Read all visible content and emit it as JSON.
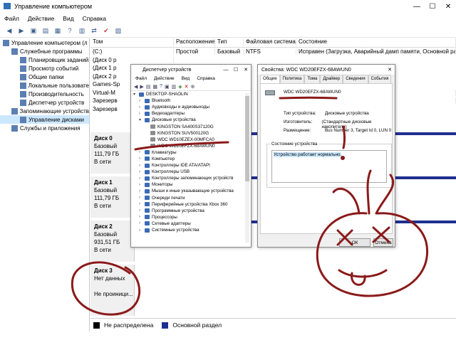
{
  "app": {
    "title": "Управление компьютером",
    "menu": [
      "Файл",
      "Действие",
      "Вид",
      "Справка"
    ]
  },
  "tree": [
    {
      "label": "Управление компьютером (л",
      "icon": "computer-icon",
      "indent": 0
    },
    {
      "label": "Служебные программы",
      "icon": "tools-icon",
      "indent": 1
    },
    {
      "label": "Планировщик заданий",
      "icon": "clock-icon",
      "indent": 2
    },
    {
      "label": "Просмотр событий",
      "icon": "event-icon",
      "indent": 2
    },
    {
      "label": "Общие папки",
      "icon": "folder-icon",
      "indent": 2
    },
    {
      "label": "Локальные пользовате",
      "icon": "users-icon",
      "indent": 2
    },
    {
      "label": "Производительность",
      "icon": "perf-icon",
      "indent": 2
    },
    {
      "label": "Диспетчер устройств",
      "icon": "device-icon",
      "indent": 2
    },
    {
      "label": "Запоминающие устройств",
      "icon": "storage-icon",
      "indent": 1
    },
    {
      "label": "Управление дисками",
      "icon": "disk-icon",
      "indent": 2,
      "selected": true
    },
    {
      "label": "Службы и приложения",
      "icon": "services-icon",
      "indent": 1
    }
  ],
  "volumes": {
    "headers": [
      "Том",
      "Расположение",
      "Тип",
      "Файловая система",
      "Состояние"
    ],
    "rows": [
      [
        "(C:)",
        "Простой",
        "Базовый",
        "NTFS",
        "Исправен (Загрузка, Аварийный дамп памяти, Основной разд"
      ],
      [
        "(Диск 0 р",
        "",
        "",
        "",
        ""
      ],
      [
        "(Диск 1 р",
        "",
        "",
        "",
        ""
      ],
      [
        "(Диск 2 р",
        "",
        "",
        "",
        ""
      ],
      [
        "Games-Sp",
        "",
        "",
        "",
        ""
      ],
      [
        "Virtual-M",
        "",
        "",
        "",
        "ой раздел)"
      ],
      [
        "Зарезерв",
        "",
        "",
        "",
        "ел)"
      ],
      [
        "Зарезерв",
        "",
        "",
        "",
        ""
      ]
    ]
  },
  "disks": [
    {
      "name": "Диск 0",
      "type": "Базовый",
      "size": "111,79 ГБ",
      "status": "В сети"
    },
    {
      "name": "Диск 1",
      "type": "Базовый",
      "size": "111,79 ГБ",
      "status": "В сети"
    },
    {
      "name": "Диск 2",
      "type": "Базовый",
      "size": "931,51 ГБ",
      "status": "В сети"
    },
    {
      "name": "Диск 3",
      "type": "Нет данных",
      "size": "",
      "status": "Не проиници..."
    }
  ],
  "legend": [
    {
      "label": "Не распределена",
      "color": "#000000"
    },
    {
      "label": "Основной раздел",
      "color": "#1f2f8f"
    }
  ],
  "device_manager": {
    "title": "Диспетчер устройств",
    "menu": [
      "Файл",
      "Действие",
      "Вид",
      "Справка"
    ],
    "items": [
      {
        "label": "DESKTOP-SHAOLIN",
        "arrow": "▾",
        "indent": 0
      },
      {
        "label": "Bluetooth",
        "arrow": "›",
        "indent": 1
      },
      {
        "label": "Аудиовходы и аудиовыходы",
        "arrow": "›",
        "indent": 1
      },
      {
        "label": "Видеоадаптеры",
        "arrow": "›",
        "indent": 1
      },
      {
        "label": "Дисковые устройства",
        "arrow": "▾",
        "indent": 1
      },
      {
        "label": "KINGSTON SA400S37120G",
        "arrow": "",
        "indent": 2
      },
      {
        "label": "KINGSTON SUV500120G",
        "arrow": "",
        "indent": 2
      },
      {
        "label": "WDC WD10EZEX-00MFCA0",
        "arrow": "",
        "indent": 2
      },
      {
        "label": "WDC WD20EFZX-68AWUN0",
        "arrow": "",
        "indent": 2
      },
      {
        "label": "Клавиатуры",
        "arrow": "›",
        "indent": 1
      },
      {
        "label": "Компьютер",
        "arrow": "›",
        "indent": 1
      },
      {
        "label": "Контроллеры IDE ATA/ATAPI",
        "arrow": "›",
        "indent": 1
      },
      {
        "label": "Контроллеры USB",
        "arrow": "›",
        "indent": 1
      },
      {
        "label": "Контроллеры запоминающих устройств",
        "arrow": "›",
        "indent": 1
      },
      {
        "label": "Мониторы",
        "arrow": "›",
        "indent": 1
      },
      {
        "label": "Мыши и иные указывающие устройства",
        "arrow": "›",
        "indent": 1
      },
      {
        "label": "Очереди печати",
        "arrow": "›",
        "indent": 1
      },
      {
        "label": "Периферийные устройства Xbox 360",
        "arrow": "›",
        "indent": 1
      },
      {
        "label": "Программные устройства",
        "arrow": "›",
        "indent": 1
      },
      {
        "label": "Процессоры",
        "arrow": "›",
        "indent": 1
      },
      {
        "label": "Сетевые адаптеры",
        "arrow": "›",
        "indent": 1
      },
      {
        "label": "Системные устройства",
        "arrow": "›",
        "indent": 1
      }
    ]
  },
  "properties": {
    "title": "Свойства: WDC WD20EFZX-68AWUN0",
    "tabs": [
      "Общие",
      "Политика",
      "Тома",
      "Драйвер",
      "Сведения",
      "События"
    ],
    "device_name": "WDC WD20EFZX-68AWUN0",
    "fields": [
      {
        "key": "Тип устройства:",
        "value": "Дисковые устройства"
      },
      {
        "key": "Изготовитель:",
        "value": "(Стандартные дисковые накопители)"
      },
      {
        "key": "Размещение:",
        "value": "Bus Number 3, Target Id 0, LUN 0"
      }
    ],
    "status_label": "Состояние устройства",
    "status_text": "Устройство работает нормально.",
    "ok": "ОК",
    "cancel": "Отмена"
  }
}
